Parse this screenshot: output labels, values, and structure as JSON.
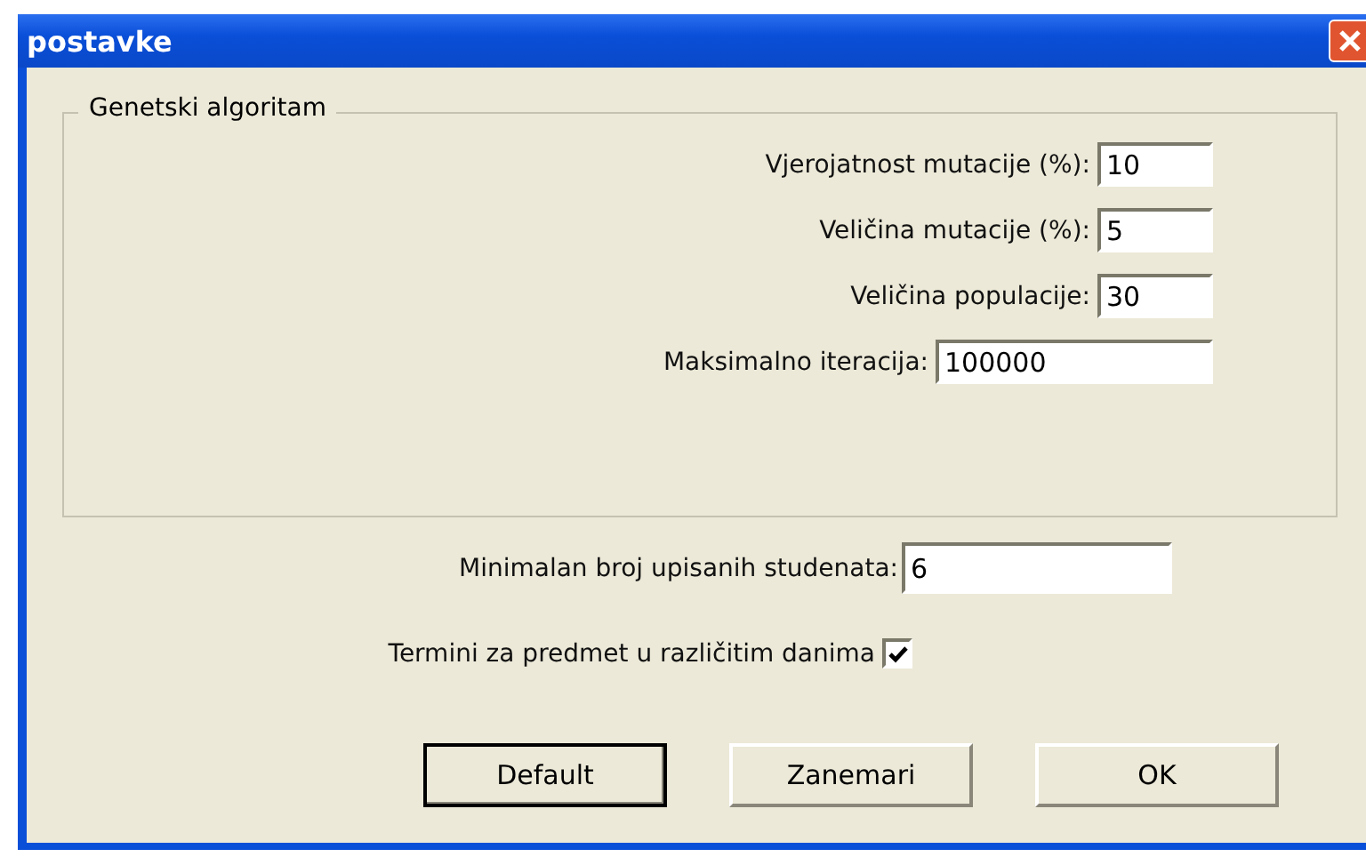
{
  "window": {
    "title": "postavke"
  },
  "group": {
    "title": "Genetski algoritam",
    "fields": [
      {
        "label": "Vjerojatnost mutacije (%):",
        "value": "10",
        "kind": "short"
      },
      {
        "label": "Veličina mutacije (%):",
        "value": "5",
        "kind": "short"
      },
      {
        "label": "Veličina populacije:",
        "value": "30",
        "kind": "short"
      },
      {
        "label": "Maksimalno iteracija:",
        "value": "100000",
        "kind": "long"
      }
    ]
  },
  "min_students": {
    "label": "Minimalan broj upisanih studenata:",
    "value": "6"
  },
  "different_days": {
    "label": "Termini za predmet u različitim danima",
    "checked": true
  },
  "buttons": [
    {
      "label": "Default",
      "default": true
    },
    {
      "label": "Zanemari",
      "default": false
    },
    {
      "label": "OK",
      "default": false
    }
  ]
}
